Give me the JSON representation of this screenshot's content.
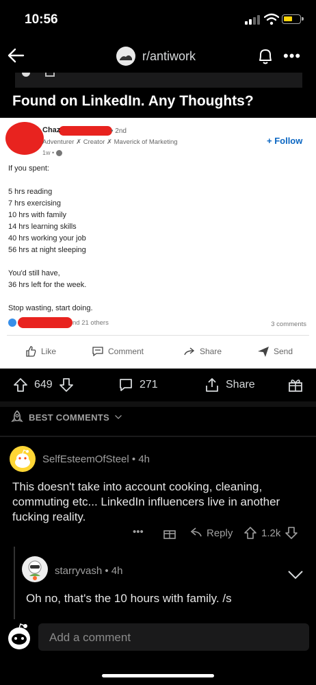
{
  "status_bar": {
    "time": "10:56"
  },
  "header": {
    "subreddit": "r/antiwork"
  },
  "post": {
    "title": "Found on LinkedIn. Any Thoughts?",
    "linkedin": {
      "name": "Chaz",
      "degree": "• 2nd",
      "headline": "Adventurer ✗ Creator ✗ Maverick of Marketing",
      "age": "1w •",
      "follow": "+ Follow",
      "body": [
        "If you spent:",
        "",
        "5 hrs reading",
        "7 hrs exercising",
        "10 hrs with family",
        "14 hrs learning skills",
        "40 hrs working your job",
        "56 hrs at night sleeping",
        "",
        "You'd still have,",
        "36 hrs left for the week.",
        "",
        "Stop wasting, start doing."
      ],
      "reactions": "nd 21 others",
      "comments": "3 comments",
      "actions": {
        "like": "Like",
        "comment": "Comment",
        "share": "Share",
        "send": "Send"
      }
    },
    "votes": "649",
    "comment_count": "271",
    "share_label": "Share"
  },
  "sort": {
    "label": "BEST COMMENTS"
  },
  "comments": [
    {
      "user": "SelfEsteemOfSteel",
      "age": "• 4h",
      "body": "This doesn't take into account cooking, cleaning, commuting etc... LinkedIn influencers live in another fucking reality.",
      "more": "•••",
      "reply": "Reply",
      "score": "1.2k"
    },
    {
      "user": "starryvash",
      "age": "• 4h",
      "body": "Oh no, that's the 10 hours with family. /s"
    }
  ],
  "footer": {
    "placeholder": "Add a comment"
  },
  "colors": {
    "background": "#000000",
    "card": "#ffffff",
    "linkedin_blue": "#0a66c2",
    "redaction": "#e8231f"
  }
}
